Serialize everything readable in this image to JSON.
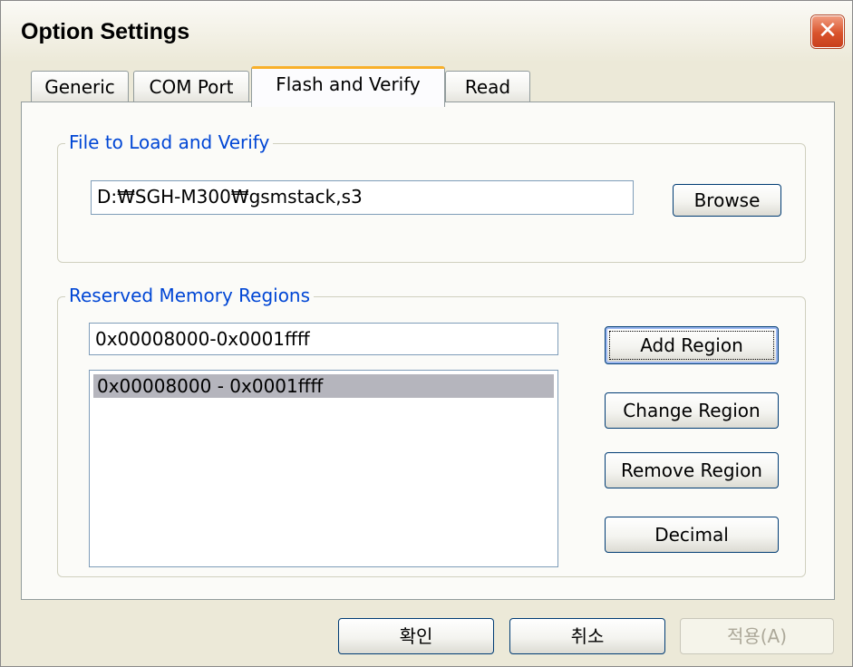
{
  "window": {
    "title": "Option Settings",
    "close_glyph": "✕"
  },
  "tabs": [
    {
      "label": "Generic"
    },
    {
      "label": "COM Port"
    },
    {
      "label": "Flash and Verify"
    },
    {
      "label": "Read"
    }
  ],
  "file_group": {
    "title": "File to Load and Verify",
    "path_value": "D:₩SGH-M300₩gsmstack,s3",
    "browse_label": "Browse"
  },
  "region_group": {
    "title": "Reserved Memory Regions",
    "input_value": "0x00008000-0x0001ffff",
    "list_items": [
      "0x00008000 - 0x0001ffff"
    ],
    "add_label": "Add Region",
    "change_label": "Change Region",
    "remove_label": "Remove Region",
    "decimal_label": "Decimal"
  },
  "footer": {
    "ok_label": "확인",
    "cancel_label": "취소",
    "apply_label": "적용(A)"
  },
  "colors": {
    "group_title": "#0046d5",
    "active_tab_accent": "#f8b02a",
    "selected_item": "#b5b5bd"
  },
  "icons": {
    "close": "close-icon"
  }
}
